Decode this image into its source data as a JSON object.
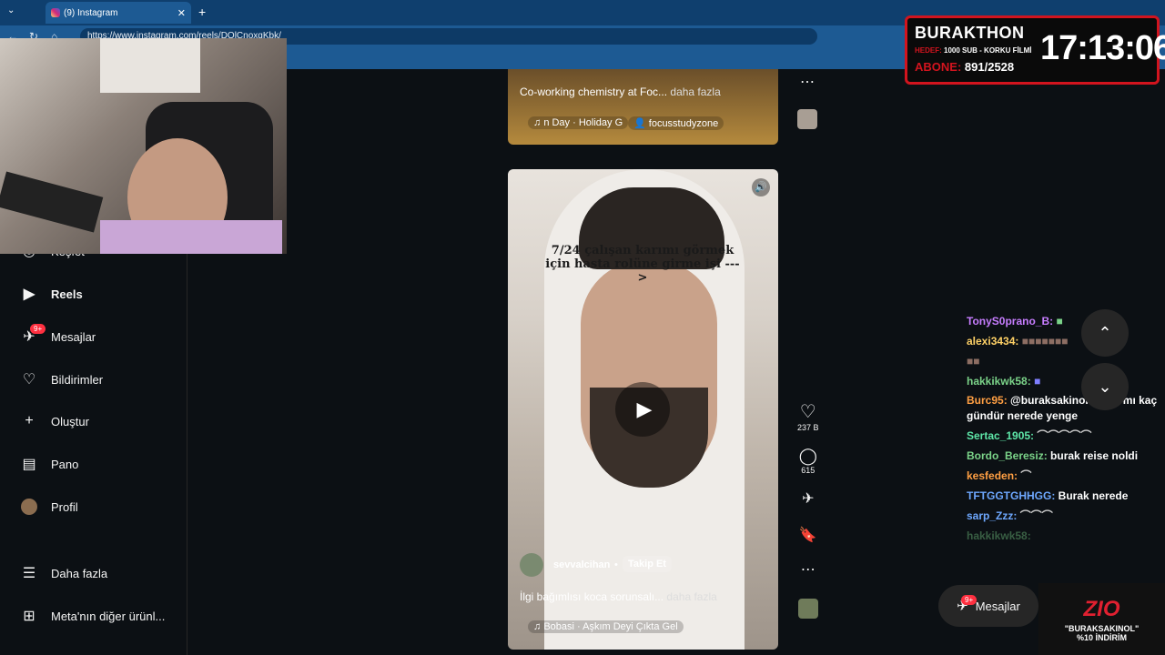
{
  "browser": {
    "tab_title": "(9) Instagram",
    "url": "https://www.instagram.com/reels/DQlCnoxqKbk/"
  },
  "sidebar": {
    "items": [
      {
        "label": "Keşfet",
        "icon": "compass-icon"
      },
      {
        "label": "Reels",
        "icon": "reels-icon"
      },
      {
        "label": "Mesajlar",
        "icon": "messages-icon",
        "badge": "9+"
      },
      {
        "label": "Bildirimler",
        "icon": "heart-icon"
      },
      {
        "label": "Oluştur",
        "icon": "plus-icon"
      },
      {
        "label": "Pano",
        "icon": "dashboard-icon"
      },
      {
        "label": "Profil",
        "icon": "avatar-icon"
      },
      {
        "label": "Daha fazla",
        "icon": "menu-icon"
      },
      {
        "label": "Meta'nın diğer ürünl...",
        "icon": "meta-icon"
      }
    ]
  },
  "reel1": {
    "caption": "Co-working chemistry at Foc...",
    "more": "daha fazla",
    "audio": "n Day · Holiday  G",
    "user_tag": "focusstudyzone"
  },
  "reel2": {
    "overlay_text": "7/24 çalışan karımı görmek için hasta rolüne girme işi --->",
    "username": "sevvalcihan",
    "follow": "Takip Et",
    "caption": "İlgi bağımlısı koca sorunsalı...",
    "more": "daha fazla",
    "audio": "Bobasi · Aşkım Deyi Çıkta Gel",
    "likes": "237 B",
    "comments": "615"
  },
  "stream": {
    "title": "BURAKTHON",
    "goal_label": "HEDEF:",
    "goal": "1000 SUB - KORKU FİLMİ",
    "sub_label": "ABONE:",
    "subs": "891/2528",
    "timer": "17:13:06"
  },
  "chat": [
    {
      "user": "TonyS0prano_B:",
      "msg": "",
      "color": "#c77dff"
    },
    {
      "user": "alexi3434:",
      "msg": "",
      "color": "#ffd166"
    },
    {
      "user": "hakkikwk58:",
      "msg": "",
      "color": "#7bd389"
    },
    {
      "user": "Burc95:",
      "msg": "@buraksakinol hasta mı kaç gündür nerede yenge",
      "color": "#ff9f43"
    },
    {
      "user": "Sertac_1905:",
      "msg": "",
      "color": "#5ee6a8"
    },
    {
      "user": "Bordo_Beresiz:",
      "msg": "burak reise noldi",
      "color": "#7bd389"
    },
    {
      "user": "kesfeden:",
      "msg": "",
      "color": "#ff9f43"
    },
    {
      "user": "TFTGGTGHHGG:",
      "msg": "Burak nerede",
      "color": "#6ea8ff"
    },
    {
      "user": "sarp_Zzz:",
      "msg": "",
      "color": "#6ea8ff"
    },
    {
      "user": "hakkikwk58:",
      "msg": "",
      "color": "#7bd389"
    }
  ],
  "messages_button": {
    "label": "Mesajlar",
    "badge": "9+"
  },
  "promo": {
    "brand": "ZIO",
    "line1": "\"BURAKSAKINOL\"",
    "line2": "%10 İNDİRİM"
  }
}
